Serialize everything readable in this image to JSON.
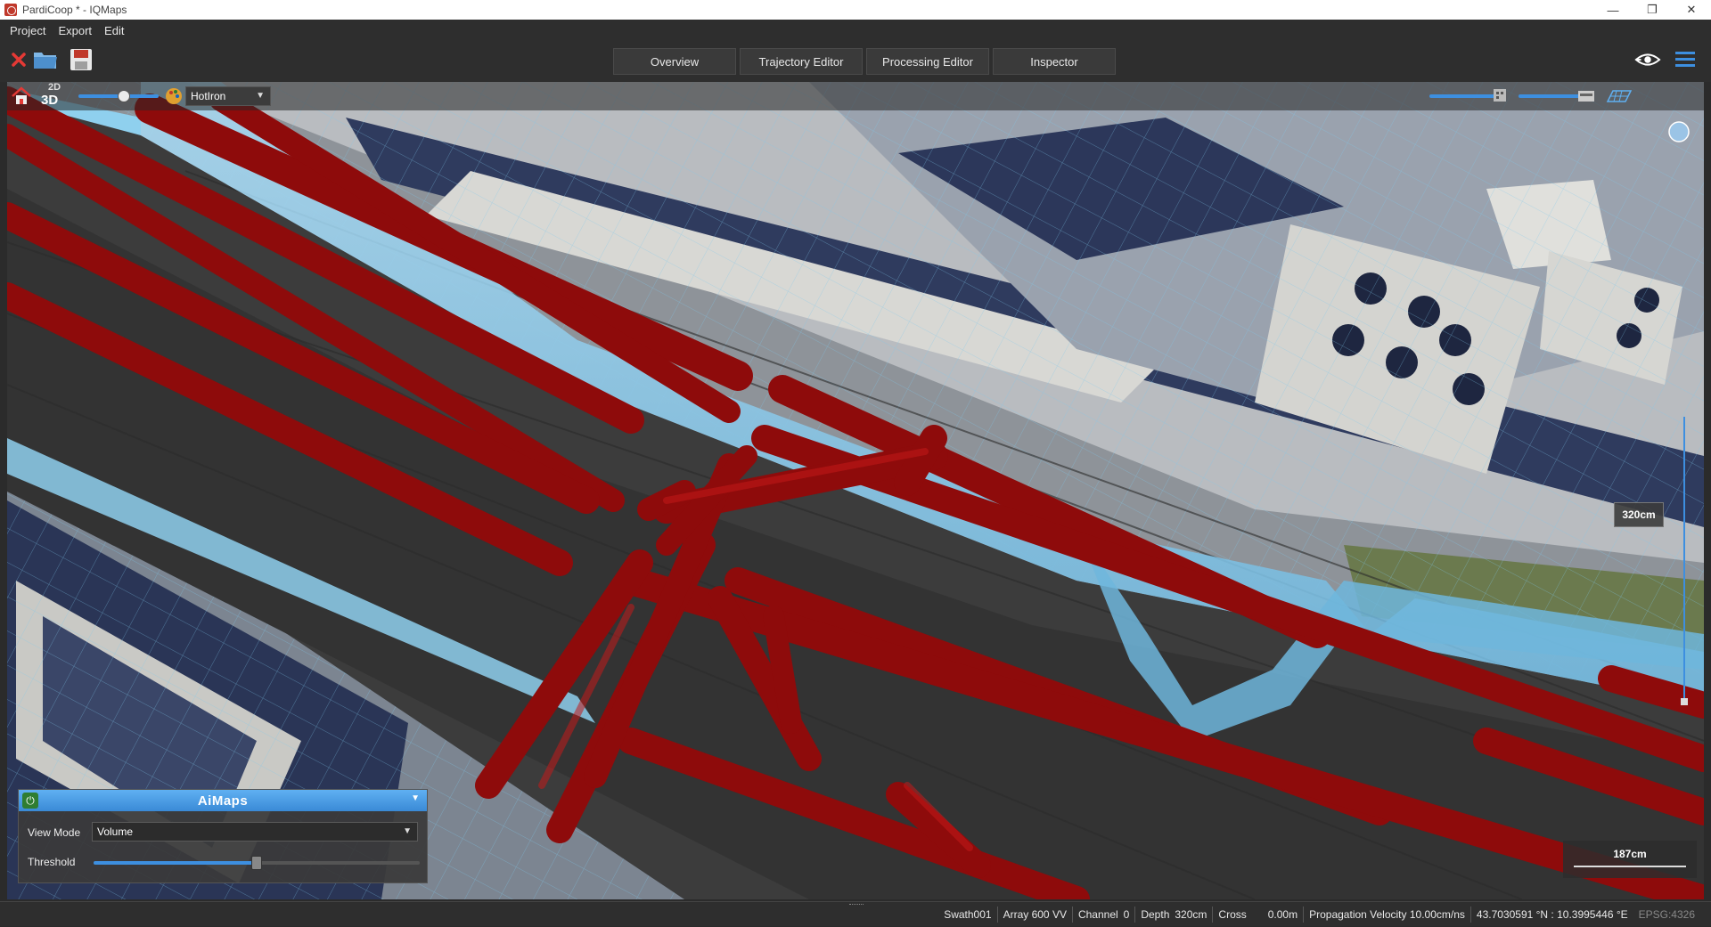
{
  "window": {
    "title": "PardiCoop * - IQMaps",
    "minimize": "—",
    "restore": "❐",
    "close": "✕"
  },
  "menu": [
    "Project",
    "Export",
    "Edit"
  ],
  "tabs": [
    "Overview",
    "Trajectory Editor",
    "Processing Editor",
    "Inspector"
  ],
  "viewport": {
    "mode_2d": "2D",
    "mode_3d": "3D",
    "palette": "HotIron",
    "depth_label": "320cm",
    "scale_label": "187cm",
    "pipe_color": "#8e0b0b",
    "grid_color": "#7ec8ec"
  },
  "aimaps": {
    "title": "AiMaps",
    "view_mode_label": "View Mode",
    "view_mode_value": "Volume",
    "threshold_label": "Threshold",
    "threshold_value": 0.5
  },
  "status": {
    "swath": "Swath001",
    "array": "Array 600 VV",
    "channel_label": "Channel",
    "channel_value": "0",
    "depth_label": "Depth",
    "depth_value": "320cm",
    "cross_label": "Cross",
    "cross_value": "0.00m",
    "velocity": "Propagation Velocity 10.00cm/ns",
    "coords": "43.7030591 °N : 10.3995446 °E",
    "epsg": "EPSG:4326"
  }
}
